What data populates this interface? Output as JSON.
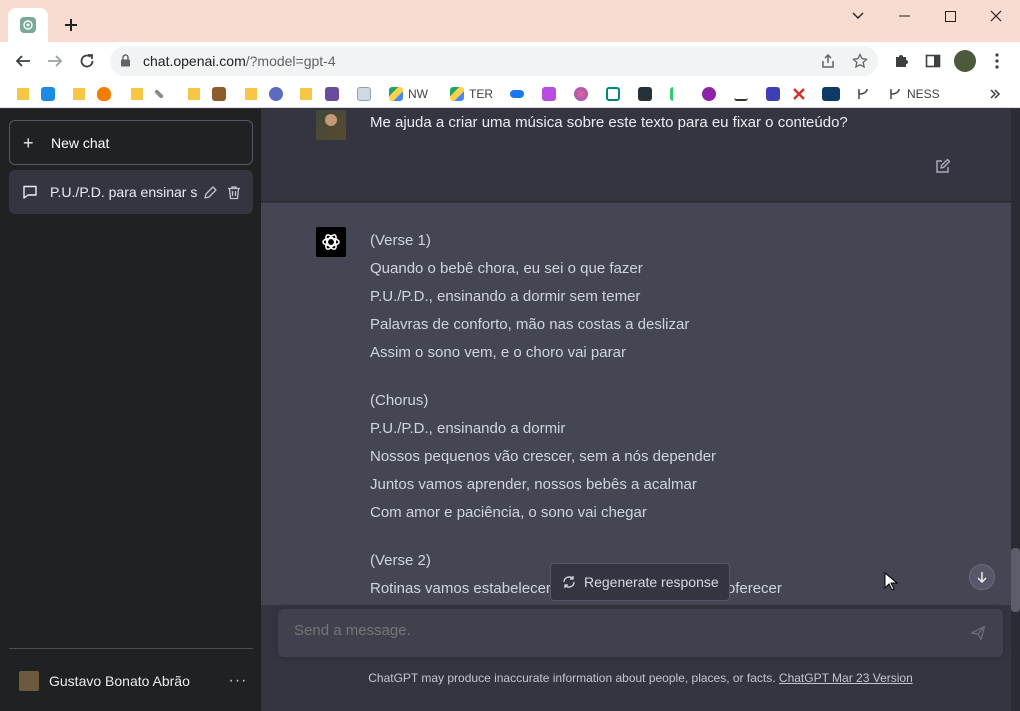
{
  "browser": {
    "url_host": "chat.openai.com",
    "url_path": "/?model=gpt-4",
    "bookmarks": [
      {
        "label": "NW"
      },
      {
        "label": "TER"
      },
      {
        "label": "NESS"
      }
    ]
  },
  "sidebar": {
    "new_chat_label": "New chat",
    "chats": [
      {
        "title": "P.U./P.D. para ensinar so"
      }
    ],
    "user_name": "Gustavo Bonato Abrão",
    "more_label": "···"
  },
  "conversation": {
    "user_message": "Me ajuda a criar uma música sobre este texto para eu fixar o conteúdo?",
    "stanzas": [
      {
        "lines": [
          "(Verse 1)",
          "Quando o bebê chora, eu sei o que fazer",
          "P.U./P.D., ensinando a dormir sem temer",
          "Palavras de conforto, mão nas costas a deslizar",
          "Assim o sono vem, e o choro vai parar"
        ]
      },
      {
        "lines": [
          "(Chorus)",
          "P.U./P.D., ensinando a dormir",
          "Nossos pequenos vão crescer, sem a nós depender",
          "Juntos vamos aprender, nossos bebês a acalmar",
          "Com amor e paciência, o sono vai chegar"
        ]
      },
      {
        "lines": [
          "(Verse 2)",
          "Rotinas vamos estabelecer, com carinho e atenção a oferecer"
        ]
      }
    ],
    "regenerate_label": "Regenerate response"
  },
  "composer": {
    "placeholder": "Send a message."
  },
  "footer": {
    "note": "ChatGPT may produce inaccurate information about people, places, or facts.",
    "link": "ChatGPT Mar 23 Version"
  }
}
